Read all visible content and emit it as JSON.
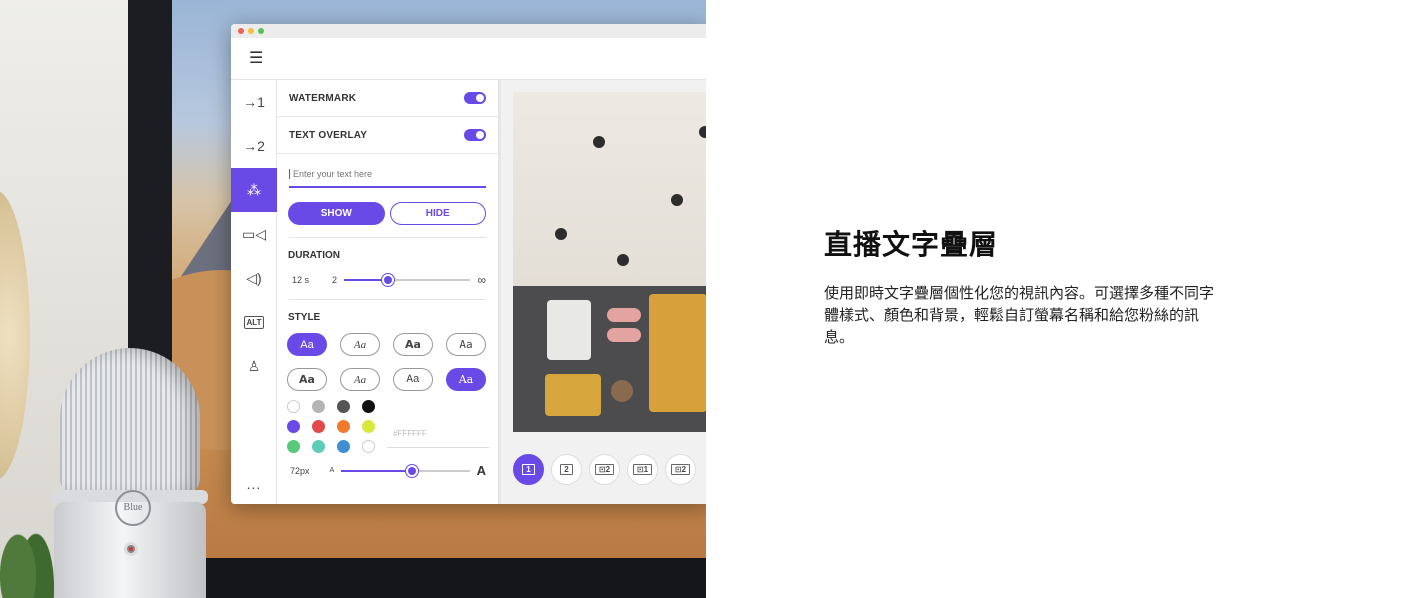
{
  "headline": "直播文字疊層",
  "description": "使用即時文字疊層個性化您的視訊內容。可選擇多種不同字體樣式、顏色和背景，輕鬆自訂螢幕名稱和給您粉絲的訊息。",
  "app": {
    "rail": {
      "items": [
        {
          "label": "→1",
          "icon": "input-1-icon"
        },
        {
          "label": "→2",
          "icon": "input-2-icon"
        },
        {
          "label": "⁂",
          "icon": "magic-wand-icon",
          "active": true
        },
        {
          "label": "▭◁",
          "icon": "camera-icon"
        },
        {
          "label": "◁)",
          "icon": "speaker-icon"
        },
        {
          "label": "ALT",
          "icon": "alt-icon"
        },
        {
          "label": "♙",
          "icon": "user-icon"
        }
      ],
      "more": "..."
    },
    "panel": {
      "watermark_label": "WATERMARK",
      "text_overlay_label": "TEXT OVERLAY",
      "text_placeholder": "Enter your text here",
      "show_label": "SHOW",
      "hide_label": "HIDE",
      "duration_label": "DURATION",
      "duration_value": "12 s",
      "duration_min": "2",
      "duration_max": "∞",
      "duration_fraction": 0.35,
      "style_label": "STYLE",
      "styles": [
        "Aa",
        "Aa",
        "Aa",
        "Aa",
        "Aa",
        "Aa",
        "Aa",
        "Aa"
      ],
      "selected_style_indices": [
        0,
        7
      ],
      "swatches": [
        "#ffffff",
        "#b5b5b5",
        "#555555",
        "#111111",
        "#6a4ae6",
        "#e24a4a",
        "#f07a2d",
        "#d7ea3b",
        "#58c97a",
        "#5ecdb8",
        "#3f8fd2",
        "#ffffff"
      ],
      "hex_value": "#FFFFFF",
      "size_value": "72px",
      "size_min": "A",
      "size_max": "A",
      "size_fraction": 0.55
    },
    "layouts": [
      "1",
      "2",
      "⊡2",
      "⊡1",
      "⊡2"
    ],
    "accent": "#6a4ae6"
  },
  "mic_brand": "Blue"
}
